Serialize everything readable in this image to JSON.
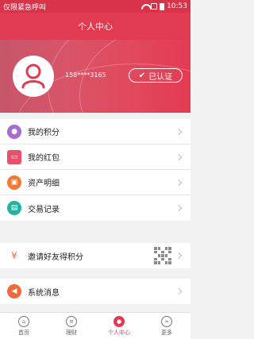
{
  "status_bar": {
    "carrier": "仅限紧急呼叫",
    "time": "10:53",
    "icons": [
      "wifi-icon",
      "sim-icon",
      "battery-icon"
    ]
  },
  "header": {
    "title": "个人中心"
  },
  "profile": {
    "phone": "158****3165",
    "verified_label": "已认证",
    "avatar_icon": "user-avatar-icon"
  },
  "menu": {
    "group1": [
      {
        "label": "我的积分",
        "icon": "points-icon",
        "color": "#a86bd1"
      },
      {
        "label": "我的红包",
        "icon": "red-envelope-icon",
        "color": "#e9506a"
      },
      {
        "label": "资产明细",
        "icon": "wallet-icon",
        "color": "#f07a34"
      },
      {
        "label": "交易记录",
        "icon": "clipboard-icon",
        "color": "#1fb3a0"
      }
    ],
    "group2": [
      {
        "label": "邀请好友得积分",
        "icon": "gift-icon",
        "color": "#f06a4a"
      }
    ],
    "group3": [
      {
        "label": "系统消息",
        "icon": "megaphone-icon",
        "color": "#f06a3a"
      }
    ]
  },
  "tabbar": [
    {
      "label": "首页",
      "icon": "home-icon"
    },
    {
      "label": "理财",
      "icon": "finance-icon"
    },
    {
      "label": "个人中心",
      "icon": "profile-icon",
      "active": true
    },
    {
      "label": "更多",
      "icon": "more-icon"
    }
  ],
  "colors": {
    "brand": "#e23a50"
  }
}
